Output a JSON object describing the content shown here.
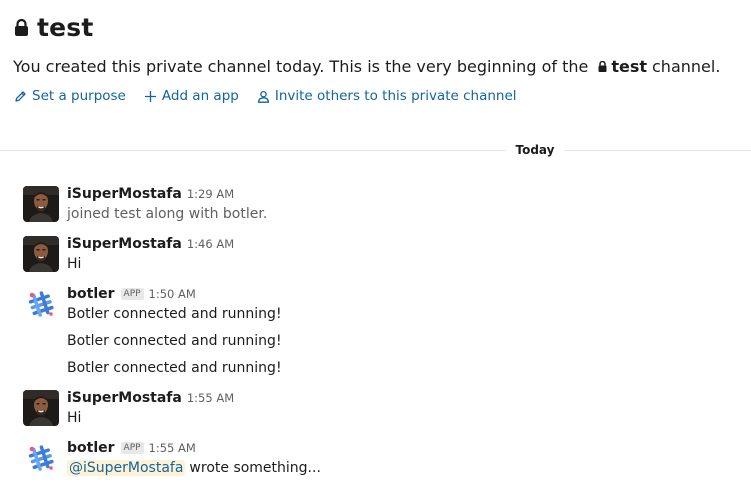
{
  "channel": {
    "name": "test"
  },
  "intro": {
    "text": "You created this private channel today. This is the very beginning of the",
    "channel_name": "test",
    "suffix": "channel."
  },
  "actions": [
    {
      "label": "Set a purpose",
      "icon": "pencil-icon"
    },
    {
      "label": "Add an app",
      "icon": "plus-icon"
    },
    {
      "label": "Invite others to this private channel",
      "icon": "person-icon"
    }
  ],
  "day_divider": "Today",
  "messages": [
    {
      "author": "iSuperMostafa",
      "time": "1:29 AM",
      "lines": [
        "joined test along with botler."
      ]
    },
    {
      "author": "iSuperMostafa",
      "time": "1:46 AM",
      "lines": [
        "Hi"
      ]
    },
    {
      "author": "botler",
      "badge": "APP",
      "time": "1:50 AM",
      "lines": [
        "Botler connected and running!",
        "Botler connected and running!",
        "Botler connected and running!"
      ]
    },
    {
      "author": "iSuperMostafa",
      "time": "1:55 AM",
      "lines": [
        "Hi"
      ]
    },
    {
      "author": "botler",
      "badge": "APP",
      "time": "1:55 AM",
      "mention": "@iSuperMostafa",
      "lines": [
        "wrote something..."
      ]
    }
  ],
  "colors": {
    "link": "#1264a3",
    "mention_bg": "#fdf3d4",
    "botler_blue": "#3e7bd6",
    "botler_pink": "#e8578c"
  }
}
